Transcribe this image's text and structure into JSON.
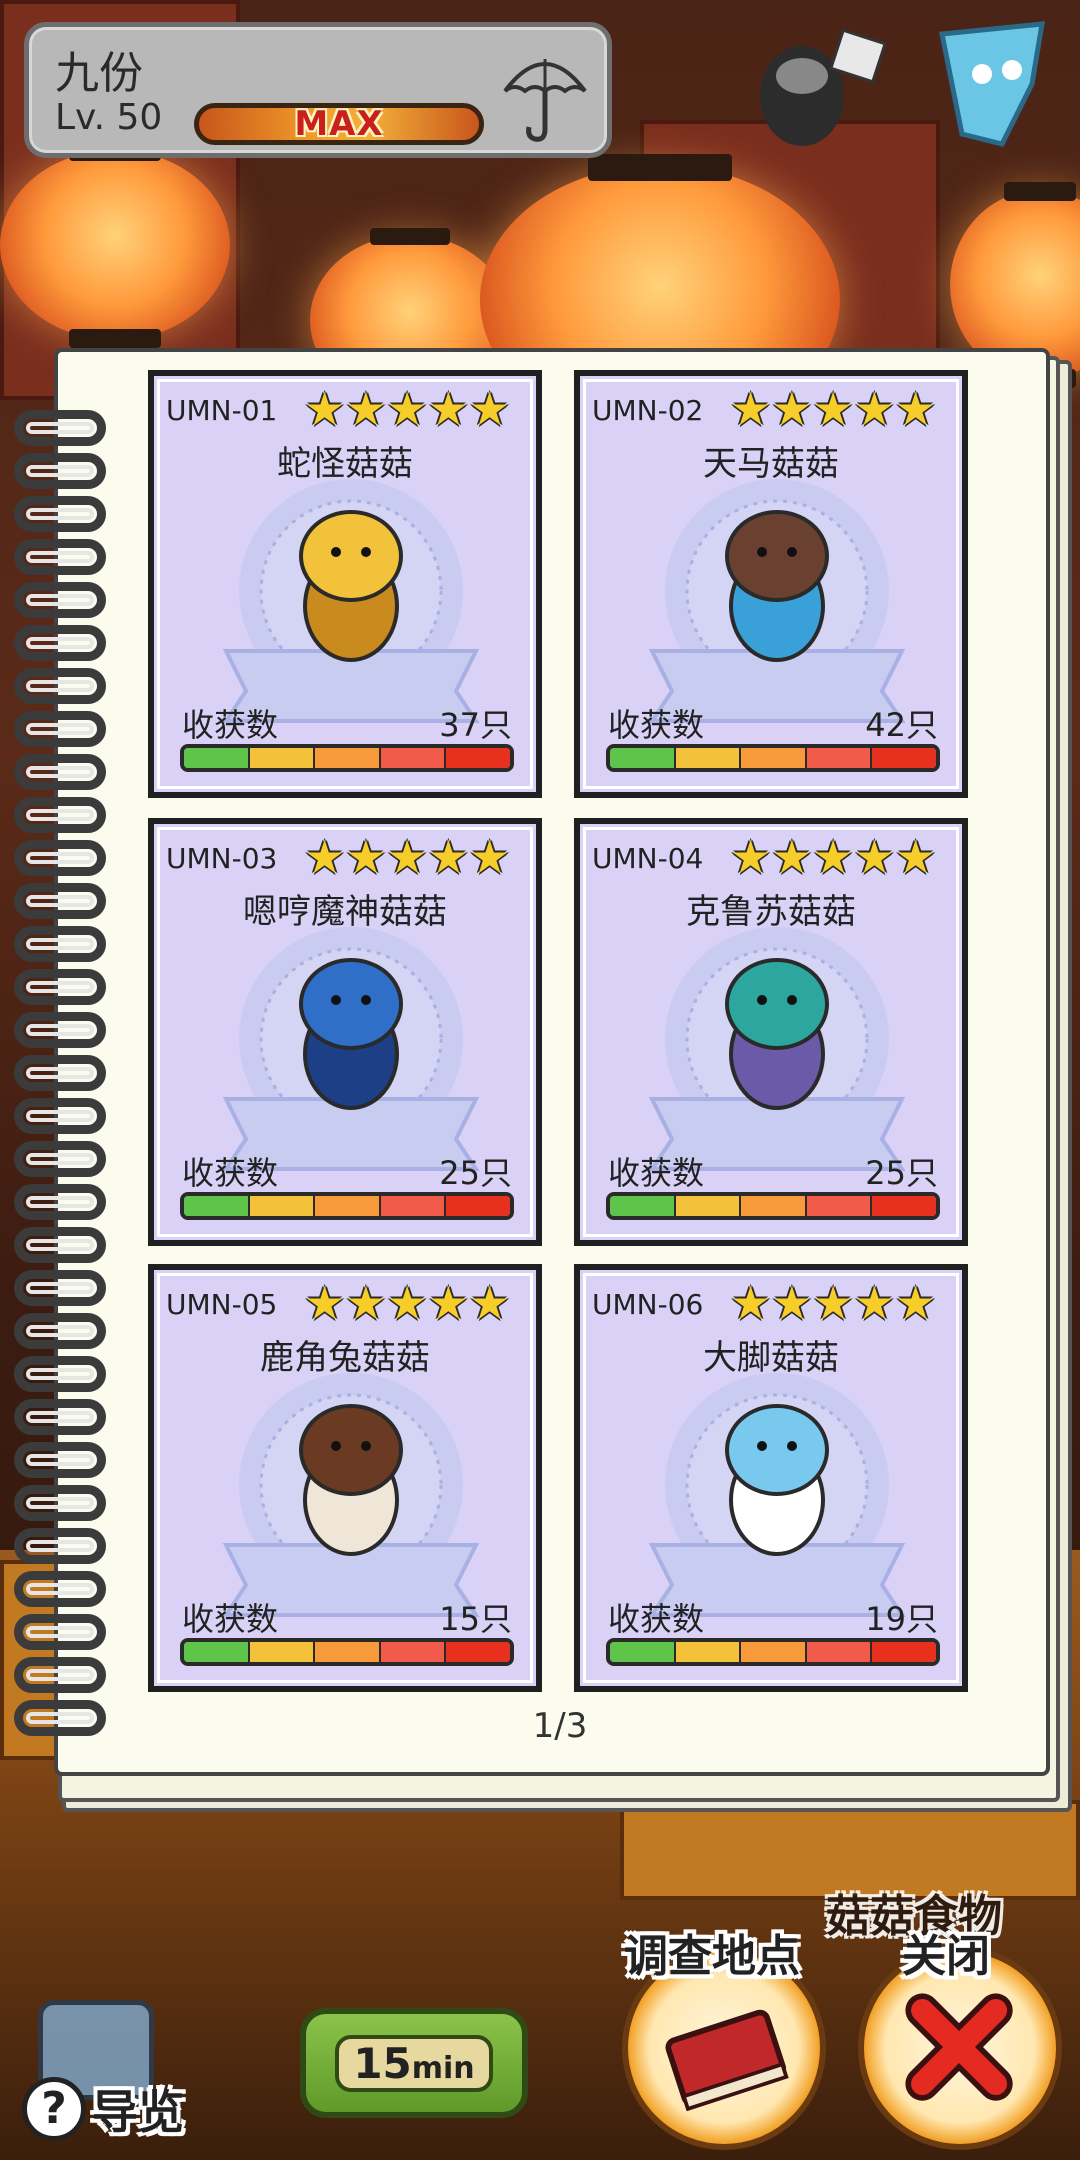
{
  "hud": {
    "player_name": "九份",
    "level": "Lv. 50",
    "level_bar_label": "MAX",
    "umbrella_icon": "umbrella-icon"
  },
  "catalog": {
    "page_indicator": "1/3",
    "harvest_label": "收获数",
    "star_glyph": "★",
    "items": [
      {
        "code": "UMN-01",
        "name": "蛇怪菇菇",
        "count": "37只",
        "stars": 5,
        "body_color": "#f2c23a",
        "accent_color": "#c98a1e"
      },
      {
        "code": "UMN-02",
        "name": "天马菇菇",
        "count": "42只",
        "stars": 5,
        "body_color": "#6a4030",
        "accent_color": "#3aa0d8"
      },
      {
        "code": "UMN-03",
        "name": "嗯哼魔神菇菇",
        "count": "25只",
        "stars": 5,
        "body_color": "#2f6fc8",
        "accent_color": "#1c3f86"
      },
      {
        "code": "UMN-04",
        "name": "克鲁苏菇菇",
        "count": "25只",
        "stars": 5,
        "body_color": "#2ea6a0",
        "accent_color": "#6a5aa8"
      },
      {
        "code": "UMN-05",
        "name": "鹿角兔菇菇",
        "count": "15只",
        "stars": 5,
        "body_color": "#6a3a22",
        "accent_color": "#f0e6d8"
      },
      {
        "code": "UMN-06",
        "name": "大脚菇菇",
        "count": "19只",
        "stars": 5,
        "body_color": "#79c8ee",
        "accent_color": "#ffffff"
      }
    ],
    "meter_colors": [
      "#5ec44a",
      "#f4c23a",
      "#f79a3a",
      "#f25a4a",
      "#e8301e"
    ]
  },
  "controls": {
    "food_label": "菇菇食物",
    "survey_label": "调查地点",
    "close_label": "关闭",
    "timer_value": "15",
    "timer_unit": "min",
    "help_glyph": "?",
    "guide_label": "导览"
  }
}
